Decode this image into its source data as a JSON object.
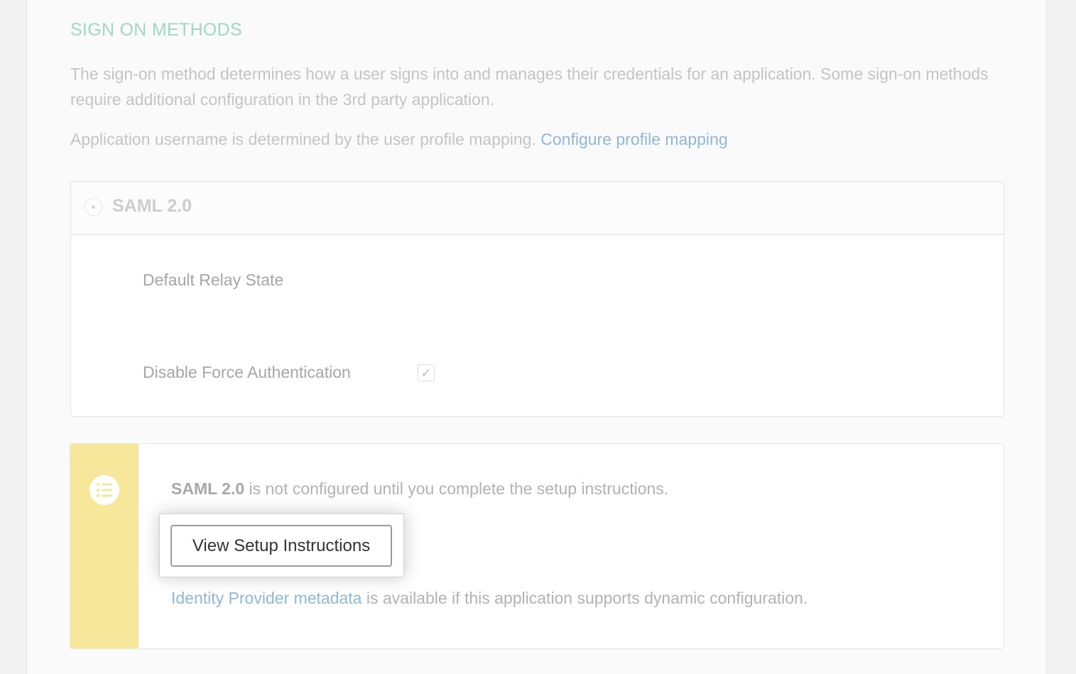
{
  "section": {
    "title": "SIGN ON METHODS",
    "description": "The sign-on method determines how a user signs into and manages their credentials for an application. Some sign-on methods require additional configuration in the 3rd party application.",
    "username_text": "Application username is determined by the user profile mapping.",
    "profile_link": "Configure profile mapping"
  },
  "method": {
    "label": "SAML 2.0",
    "selected": true,
    "fields": {
      "relay_state_label": "Default Relay State",
      "force_auth_label": "Disable Force Authentication",
      "force_auth_checked": true,
      "check_glyph": "✓"
    }
  },
  "notice": {
    "icon": "list-icon",
    "stripe_color": "#f7e79b",
    "method_name": "SAML 2.0",
    "message": " is not configured until you complete the setup instructions.",
    "button_label": "View Setup Instructions",
    "metadata_link": "Identity Provider metadata",
    "metadata_text": " is available if this application supports dynamic configuration."
  },
  "colors": {
    "section_title": "#9ed8c4",
    "link": "#8fb8d6"
  }
}
